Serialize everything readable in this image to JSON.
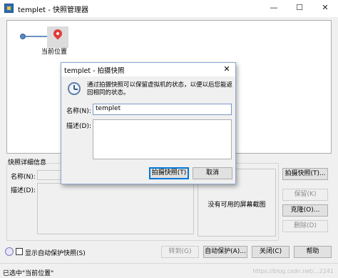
{
  "window": {
    "title": "templet - 快照管理器",
    "minimize": "—",
    "maximize": "☐",
    "close": "✕"
  },
  "tree": {
    "current_location": "当前位置"
  },
  "details": {
    "title": "快照详细信息",
    "name_label": "名称(N):",
    "desc_label": "描述(D):",
    "no_screenshot": "没有可用的屏幕截图"
  },
  "side_buttons": {
    "take_snapshot": "拍摄快照(T)...",
    "keep": "保留(K)",
    "clone": "克隆(O)...",
    "delete": "删除(D)"
  },
  "bottom": {
    "show_auto_protect": "显示自动保护快照(S)",
    "goto": "转到(G)",
    "auto_protect": "自动保护(A)...",
    "close": "关闭(C)",
    "help": "帮助"
  },
  "status": {
    "text": "已选中\"当前位置\"",
    "watermark": "https://blog.csdn.net/...2241"
  },
  "dialog": {
    "title": "templet - 拍摄快照",
    "close": "✕",
    "description": "通过拍摄快照可以保留虚拟机的状态，以便以后您能返回相同的状态。",
    "name_label": "名称(N):",
    "name_value": "templet",
    "desc_label": "描述(D):",
    "take_button": "拍摄快照(T)",
    "cancel_button": "取消"
  }
}
